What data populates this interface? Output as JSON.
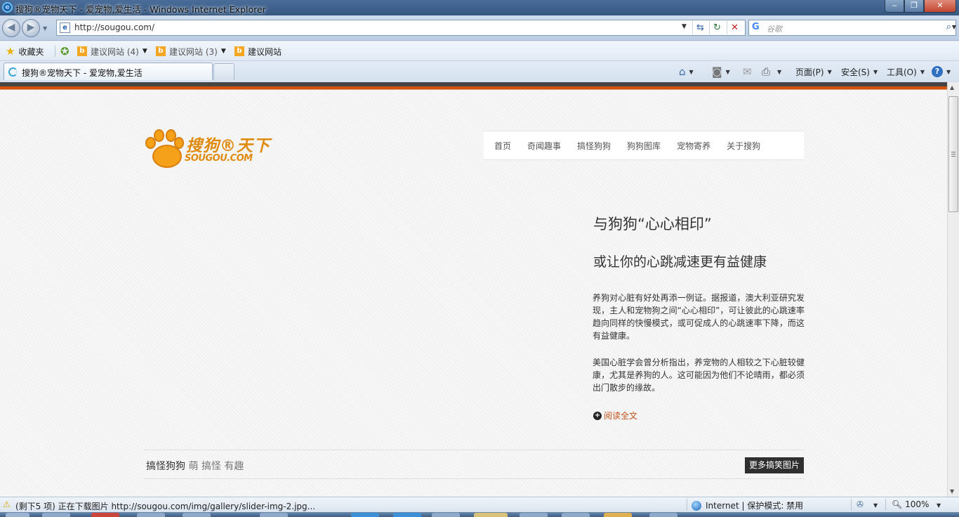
{
  "window": {
    "title": "搜狗®宠物天下 - 爱宠物,爱生活 - Windows Internet Explorer",
    "ie_logo": "e",
    "minimize": "‒",
    "maximize": "❐",
    "close": "✕"
  },
  "address_bar": {
    "page_icon": "e",
    "url": "http://sougou.com/",
    "dropdown": "▼",
    "compat_icon": "⇆",
    "refresh_icon": "↻",
    "stop_icon": "✕"
  },
  "search": {
    "engine_icon": "G",
    "placeholder": "谷歌",
    "go_icon": "⌕",
    "dropdown": "▼"
  },
  "nav": {
    "back": "◀",
    "forward": "▶",
    "history_dropdown": "▼"
  },
  "favorites_bar": {
    "favorites_label": "收藏夹",
    "items": [
      {
        "label": "建议网站 (4)",
        "icon": "b",
        "has_dropdown": true
      },
      {
        "label": "建议网站 (3)",
        "icon": "b",
        "has_dropdown": true
      },
      {
        "label": "建议网站",
        "icon": "b",
        "has_dropdown": false
      }
    ]
  },
  "tabs": [
    {
      "title": "搜狗®宠物天下 - 爱宠物,爱生活",
      "active": true,
      "loading": true
    }
  ],
  "command_bar": {
    "home_icon": "⌂",
    "feeds_icon": "◙",
    "mail_icon": "✉",
    "print_icon": "⎙",
    "page_label": "页面(P)",
    "safety_label": "安全(S)",
    "tools_label": "工具(O)",
    "help_icon": "?"
  },
  "site": {
    "logo_text_cn": "搜狗®天下",
    "logo_text_en": "SOUGOU.COM",
    "nav": [
      "首页",
      "奇闻趣事",
      "搞怪狗狗",
      "狗狗图库",
      "宠物寄养",
      "关于搜狗"
    ],
    "article": {
      "title": "与狗狗“心心相印”",
      "subtitle": "或让你的心跳减速更有益健康",
      "paragraphs": [
        "养狗对心脏有好处再添一例证。据报道，澳大利亚研究发现，主人和宠物狗之间“心心相印”，可让彼此的心跳速率趋向同样的快慢模式，或可促成人的心跳速率下降，而这有益健康。",
        "美国心脏学会曾分析指出，养宠物的人相较之下心脏较健康，尤其是养狗的人。这可能因为他们不论晴雨，都必须出门散步的缘故。"
      ],
      "read_more": "阅读全文"
    },
    "section": {
      "title": "搞怪狗狗",
      "tagline": "萌 搞怪 有趣",
      "more_button": "更多搞笑图片"
    }
  },
  "status_bar": {
    "message": "(剩下5 项) 正在下载图片 http://sougou.com/img/gallery/slider-img-2.jpg...",
    "zone": "Internet | 保护模式: 禁用",
    "zoom": "100%"
  },
  "colors": {
    "accent_orange": "#d2520c",
    "logo_orange": "#f5a11a",
    "link_orange": "#c2511b",
    "button_dark": "#2f2f2f"
  }
}
